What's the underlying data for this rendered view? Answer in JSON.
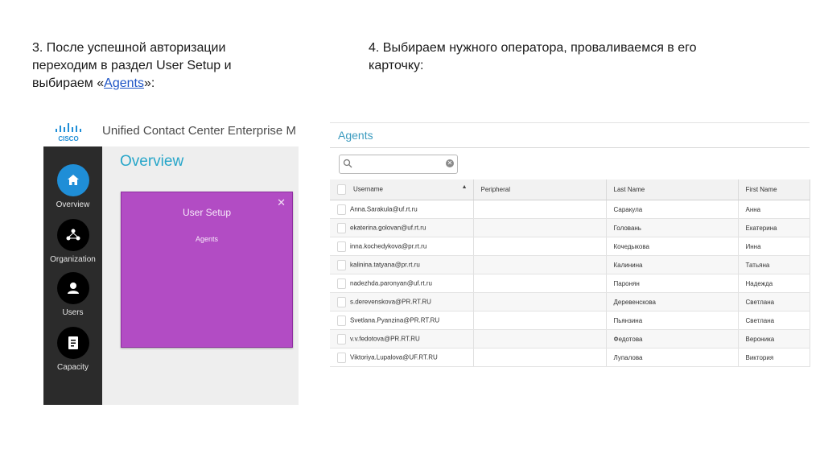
{
  "captions": {
    "left_line1": "3. После успешной авторизации",
    "left_line2": "переходим в раздел User Setup и",
    "left_line3_prefix": "выбираем «",
    "left_link": "Agents",
    "left_line3_suffix": "»:",
    "right_line1": "4. Выбираем нужного оператора, проваливаемся в его",
    "right_line2": "карточку:"
  },
  "ucce": {
    "app_title": "Unified Contact Center Enterprise M",
    "logo_text": "CISCO",
    "nav": [
      {
        "label": "Overview",
        "icon": "home-icon",
        "active": true
      },
      {
        "label": "Organization",
        "icon": "organization-icon",
        "active": false
      },
      {
        "label": "Users",
        "icon": "user-icon",
        "active": false
      },
      {
        "label": "Capacity",
        "icon": "document-icon",
        "active": false
      }
    ],
    "page_title": "Overview",
    "card": {
      "title": "User Setup",
      "link": "Agents",
      "close": "✕"
    },
    "colors": {
      "accent": "#1f8ed7",
      "card": "#b24cc4",
      "title": "#27a6c9",
      "sidebar": "#2b2b2b"
    }
  },
  "agents": {
    "title": "Agents",
    "search_placeholder": "",
    "columns": [
      "Username",
      "Peripheral",
      "Last Name",
      "First Name"
    ],
    "rows": [
      {
        "username": "Anna.Sarakula@uf.rt.ru",
        "peripheral": "",
        "last_name": "Саракула",
        "first_name": "Анна"
      },
      {
        "username": "ekaterina.golovan@uf.rt.ru",
        "peripheral": "",
        "last_name": "Головань",
        "first_name": "Екатерина"
      },
      {
        "username": "inna.kochedykova@pr.rt.ru",
        "peripheral": "",
        "last_name": "Кочедыкова",
        "first_name": "Инна"
      },
      {
        "username": "kalinina.tatyana@pr.rt.ru",
        "peripheral": "",
        "last_name": "Калинина",
        "first_name": "Татьяна"
      },
      {
        "username": "nadezhda.paronyan@uf.rt.ru",
        "peripheral": "",
        "last_name": "Паронян",
        "first_name": "Надежда"
      },
      {
        "username": "s.derevenskova@PR.RT.RU",
        "peripheral": "",
        "last_name": "Деревенскова",
        "first_name": "Светлана"
      },
      {
        "username": "Svetlana.Pyanzina@PR.RT.RU",
        "peripheral": "",
        "last_name": "Пьянзина",
        "first_name": "Светлана"
      },
      {
        "username": "v.v.fedotova@PR.RT.RU",
        "peripheral": "",
        "last_name": "Федотова",
        "first_name": "Вероника"
      },
      {
        "username": "Viktoriya.Lupalova@UF.RT.RU",
        "peripheral": "",
        "last_name": "Лупалова",
        "first_name": "Виктория"
      }
    ]
  }
}
